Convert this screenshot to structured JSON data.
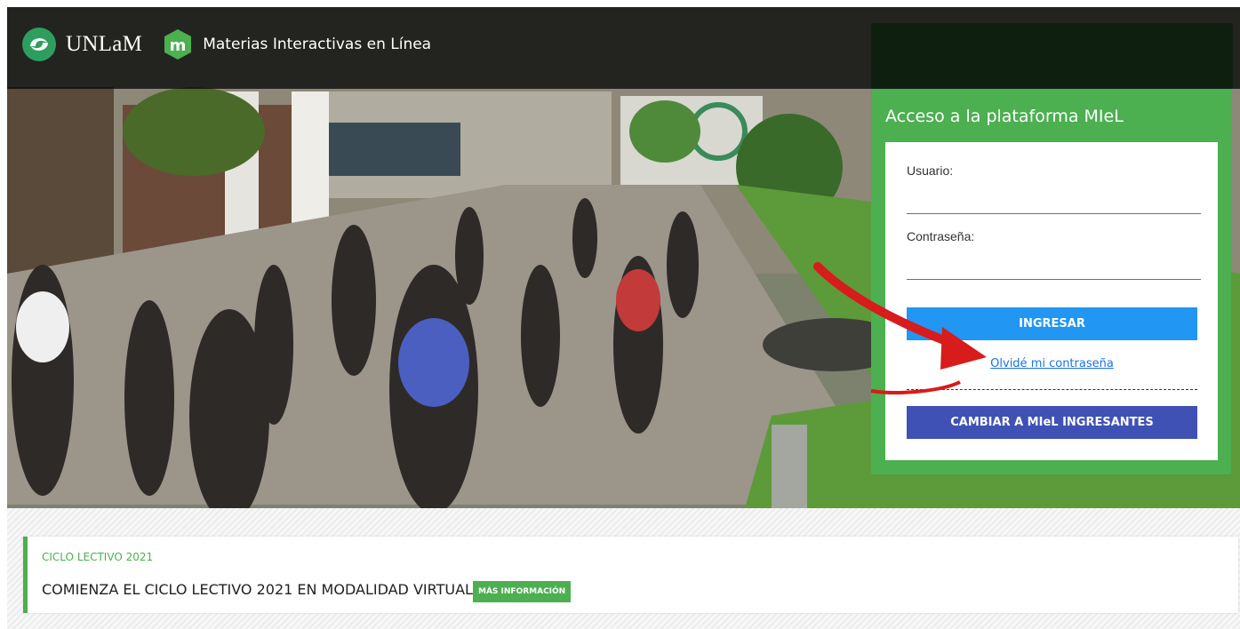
{
  "header": {
    "university_name": "UNLaM",
    "platform_name": "Materias Interactivas en Línea",
    "logo_icon": "unlam-swirl-logo",
    "platform_icon": "miel-m-logo"
  },
  "login": {
    "title": "Acceso a la plataforma MIeL",
    "username_label": "Usuario:",
    "password_label": "Contraseña:",
    "submit_label": "INGRESAR",
    "forgot_label": "Olvidé mi contraseña",
    "switch_label": "CAMBIAR A MIeL INGRESANTES"
  },
  "announcement": {
    "category": "CICLO LECTIVO 2021",
    "text": "COMIENZA EL CICLO LECTIVO 2021 EN MODALIDAD VIRTUAL.",
    "button_label": "MÁS INFORMACIÓN"
  },
  "colors": {
    "brand_green": "#4caf50",
    "primary_blue": "#2196f3",
    "indigo": "#3f51b5",
    "arrow_red": "#d81b1b"
  }
}
